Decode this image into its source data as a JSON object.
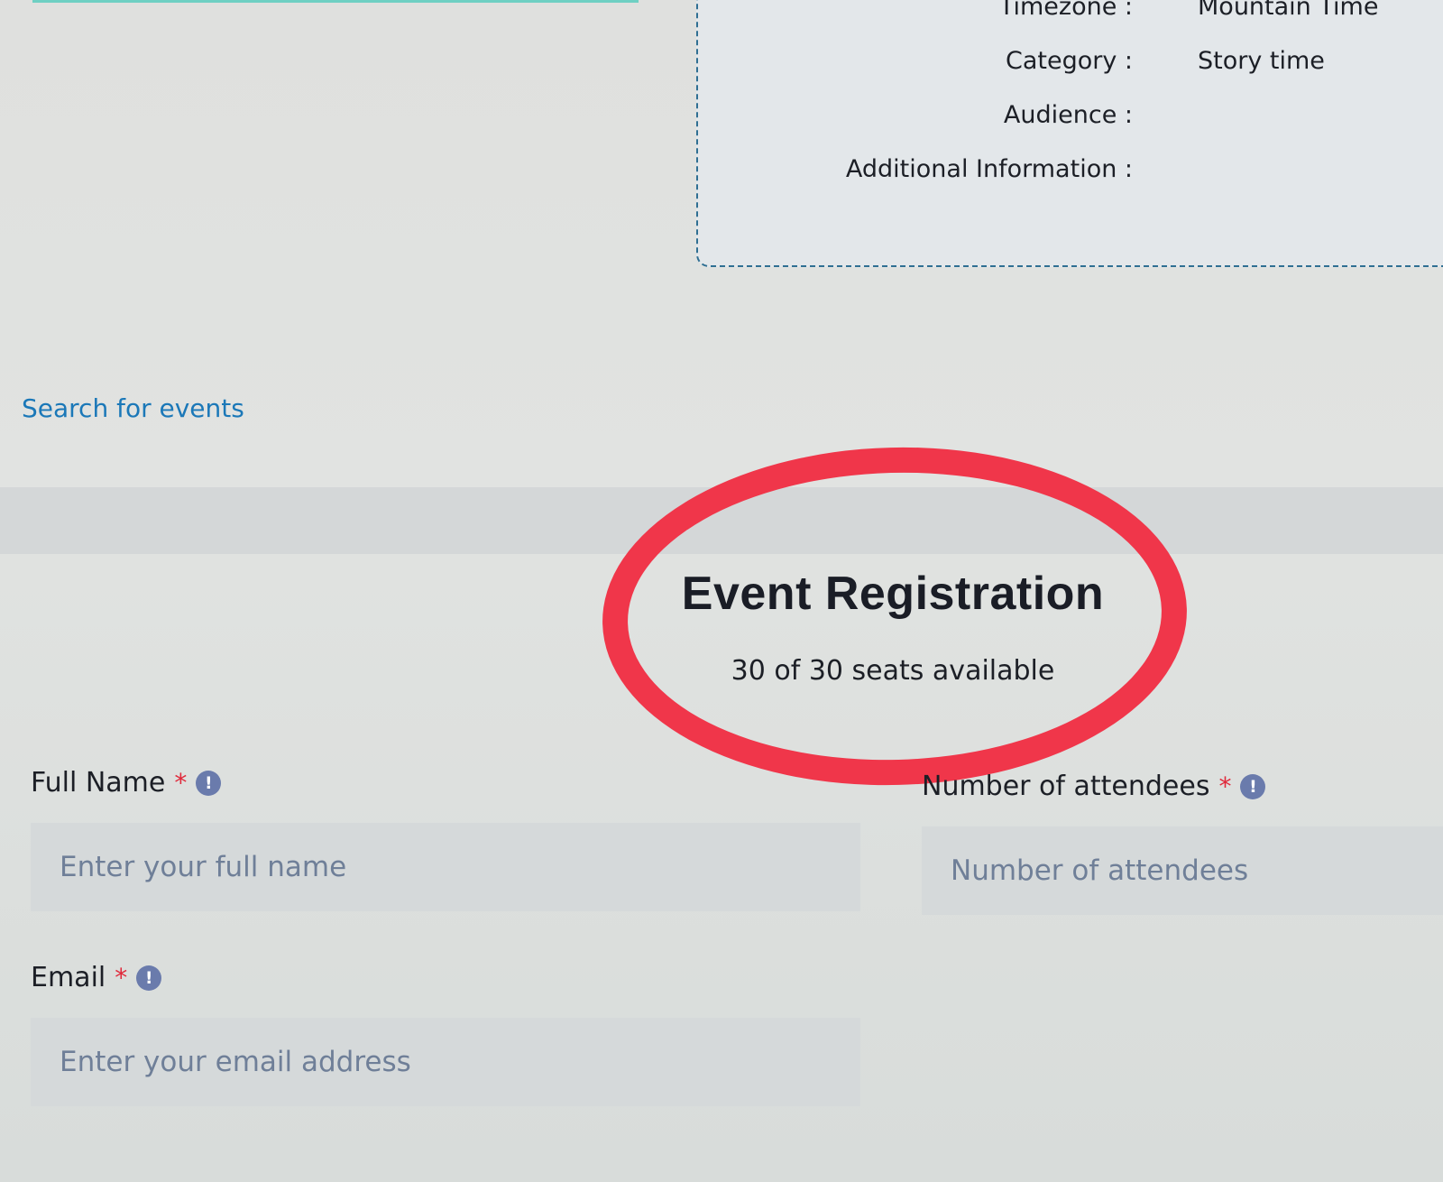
{
  "details": {
    "rows": [
      {
        "label": "Timezone :",
        "value": "Mountain Time"
      },
      {
        "label": "Category :",
        "value": "Story time"
      },
      {
        "label": "Audience :",
        "value": ""
      },
      {
        "label": "Additional Information :",
        "value": ""
      }
    ]
  },
  "nav": {
    "search_link": "Search for events"
  },
  "registration": {
    "title": "Event Registration",
    "seats": "30 of 30 seats available"
  },
  "form": {
    "full_name": {
      "label": "Full Name",
      "required_mark": "*",
      "info_icon": "!",
      "placeholder": "Enter your full name"
    },
    "attendees": {
      "label": "Number of attendees",
      "required_mark": "*",
      "info_icon": "!",
      "placeholder": "Number of attendees"
    },
    "email": {
      "label": "Email",
      "required_mark": "*",
      "info_icon": "!",
      "placeholder": "Enter your email address"
    }
  },
  "colors": {
    "accent_link": "#1b78b8",
    "highlight_ring": "#f0364a",
    "required": "#e0293b",
    "info_icon": "#6a7bac"
  },
  "icons": [
    "info-icon"
  ]
}
